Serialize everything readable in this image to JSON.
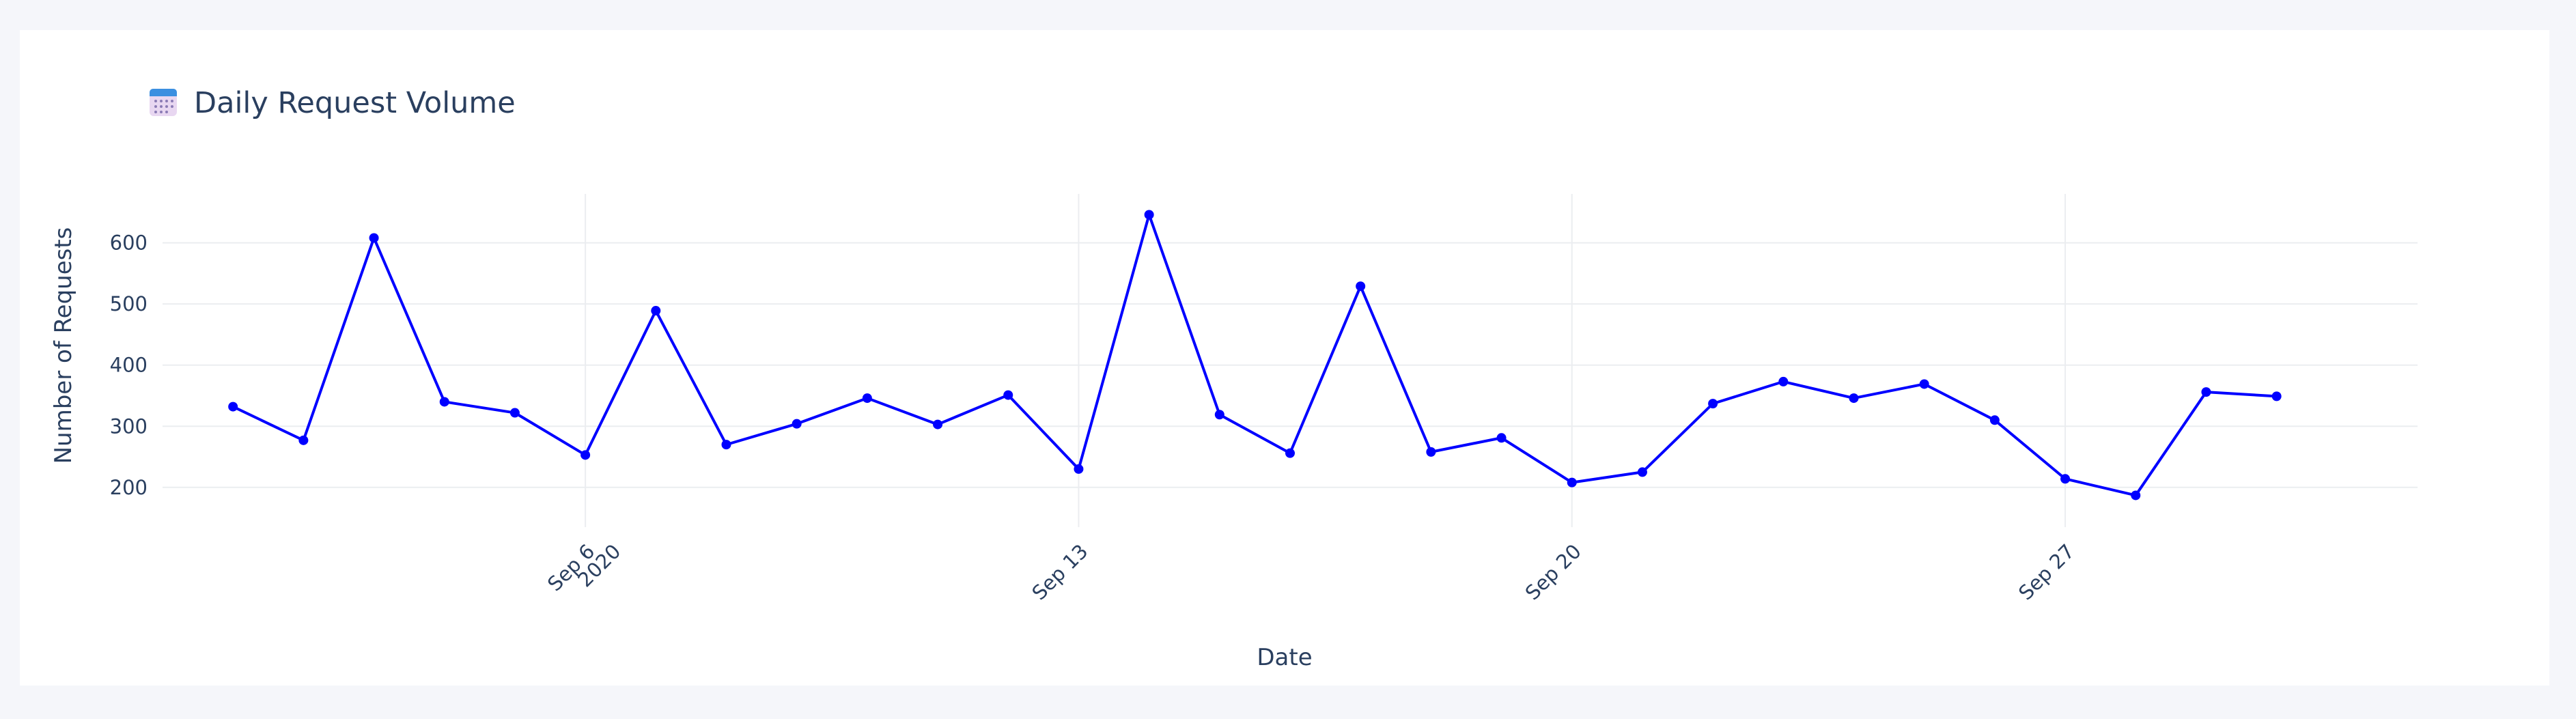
{
  "title_icon": "calendar-icon",
  "chart_data": {
    "type": "line",
    "title": "Daily Request Volume",
    "xlabel": "Date",
    "ylabel": "Number of Requests",
    "x_tick_labels": [
      {
        "date": "2020-09-06",
        "label": "Sep 6",
        "sublabel": "2020"
      },
      {
        "date": "2020-09-13",
        "label": "Sep 13",
        "sublabel": ""
      },
      {
        "date": "2020-09-20",
        "label": "Sep 20",
        "sublabel": ""
      },
      {
        "date": "2020-09-27",
        "label": "Sep 27",
        "sublabel": ""
      }
    ],
    "y_ticks": [
      200,
      300,
      400,
      500,
      600
    ],
    "ylim": [
      135,
      680
    ],
    "xlim": [
      "2020-08-31",
      "2020-10-02"
    ],
    "grid": true,
    "line_color": "#0000ff",
    "series": [
      {
        "x": [
          "2020-09-01",
          "2020-09-02",
          "2020-09-03",
          "2020-09-04",
          "2020-09-05",
          "2020-09-06",
          "2020-09-07",
          "2020-09-08",
          "2020-09-09",
          "2020-09-10",
          "2020-09-11",
          "2020-09-12",
          "2020-09-13",
          "2020-09-14",
          "2020-09-15",
          "2020-09-16",
          "2020-09-17",
          "2020-09-18",
          "2020-09-19",
          "2020-09-20",
          "2020-09-21",
          "2020-09-22",
          "2020-09-23",
          "2020-09-24",
          "2020-09-25",
          "2020-09-26",
          "2020-09-27",
          "2020-09-28",
          "2020-09-29",
          "2020-09-30"
        ],
        "values": [
          332,
          277,
          608,
          340,
          322,
          253,
          489,
          270,
          304,
          346,
          303,
          351,
          230,
          646,
          319,
          256,
          529,
          258,
          281,
          208,
          225,
          337,
          373,
          346,
          369,
          310,
          214,
          187,
          356,
          349
        ]
      }
    ]
  }
}
